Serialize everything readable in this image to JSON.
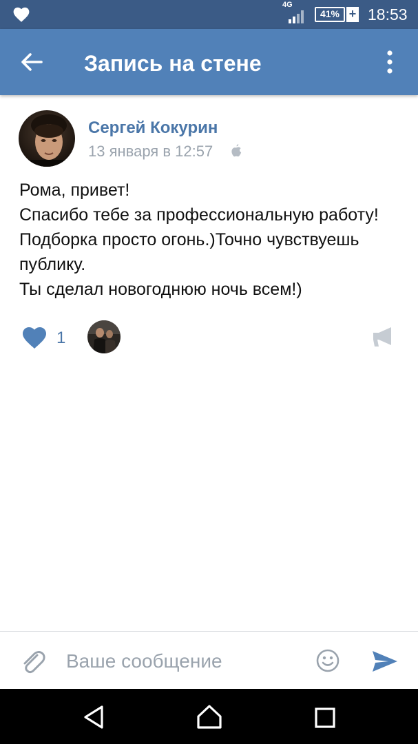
{
  "status_bar": {
    "network": "4G",
    "battery": "41%",
    "battery_charging_symbol": "+",
    "time": "18:53",
    "icons": [
      "heart-icon",
      "signal-icon",
      "battery-icon"
    ]
  },
  "app_bar": {
    "title": "Запись на стене",
    "icons": [
      "back-arrow-icon",
      "more-vert-icon"
    ]
  },
  "post": {
    "author": "Сергей Кокурин",
    "date": "13 января в 12:57",
    "platform_icon": "apple-icon",
    "text_lines": [
      "Рома, привет!",
      "Спасибо тебе за профессиональную работу!",
      "Подборка просто огонь.)Точно чувствуешь",
      "публику.",
      "Ты сделал новогоднюю ночь всем!)"
    ],
    "likes_count": "1",
    "icons": [
      "heart-icon",
      "megaphone-icon"
    ]
  },
  "composer": {
    "placeholder": "Ваше сообщение",
    "value": "",
    "icons": [
      "paperclip-icon",
      "smile-icon",
      "send-icon"
    ]
  },
  "nav_bar": {
    "icons": [
      "back-triangle-icon",
      "home-icon",
      "recents-icon"
    ]
  },
  "colors": {
    "status_bar": "#3b5b86",
    "app_bar": "#5181b8",
    "link": "#4a76a8",
    "muted": "#9aa3ad"
  }
}
